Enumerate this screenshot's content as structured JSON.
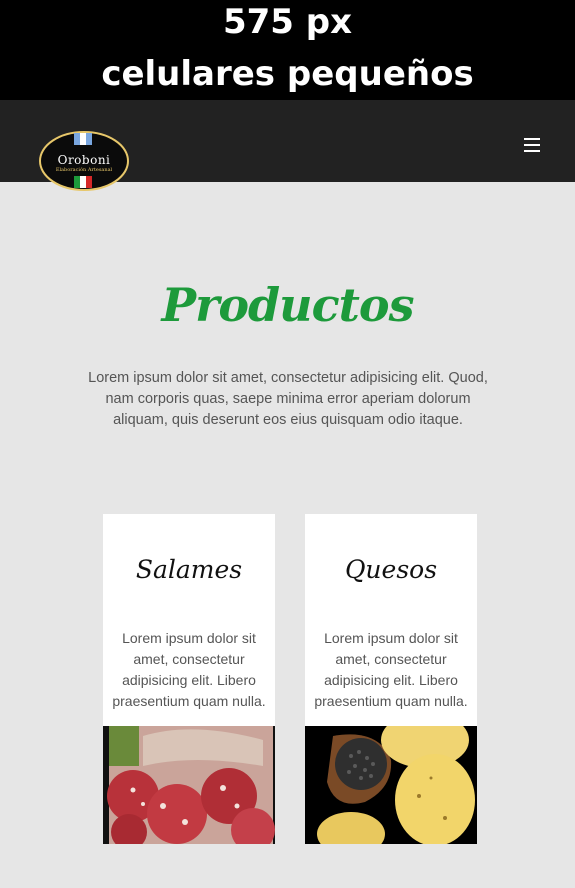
{
  "caption": {
    "line1": "575 px",
    "line2": "celulares pequeños"
  },
  "navbar": {
    "logo_text": "Oroboni",
    "logo_subtitle": "Elaboración Artesanal",
    "menu_icon": "hamburger-icon"
  },
  "main": {
    "title": "Productos",
    "intro": "Lorem ipsum dolor sit amet, consectetur adipisicing elit. Quod, nam corporis quas, saepe minima error aperiam dolorum aliquam, quis deserunt eos eius quisquam odio itaque."
  },
  "cards": [
    {
      "title": "Salames",
      "text": "Lorem ipsum dolor sit amet, consectetur adipisicing elit. Libero praesentium quam nulla."
    },
    {
      "title": "Quesos",
      "text": "Lorem ipsum dolor sit amet, consectetur adipisicing elit. Libero praesentium quam nulla."
    }
  ],
  "colors": {
    "navbar_bg": "#222222",
    "page_bg": "#e6e6e6",
    "title_green": "#1d9a3b",
    "logo_gold": "#e7c76a"
  }
}
